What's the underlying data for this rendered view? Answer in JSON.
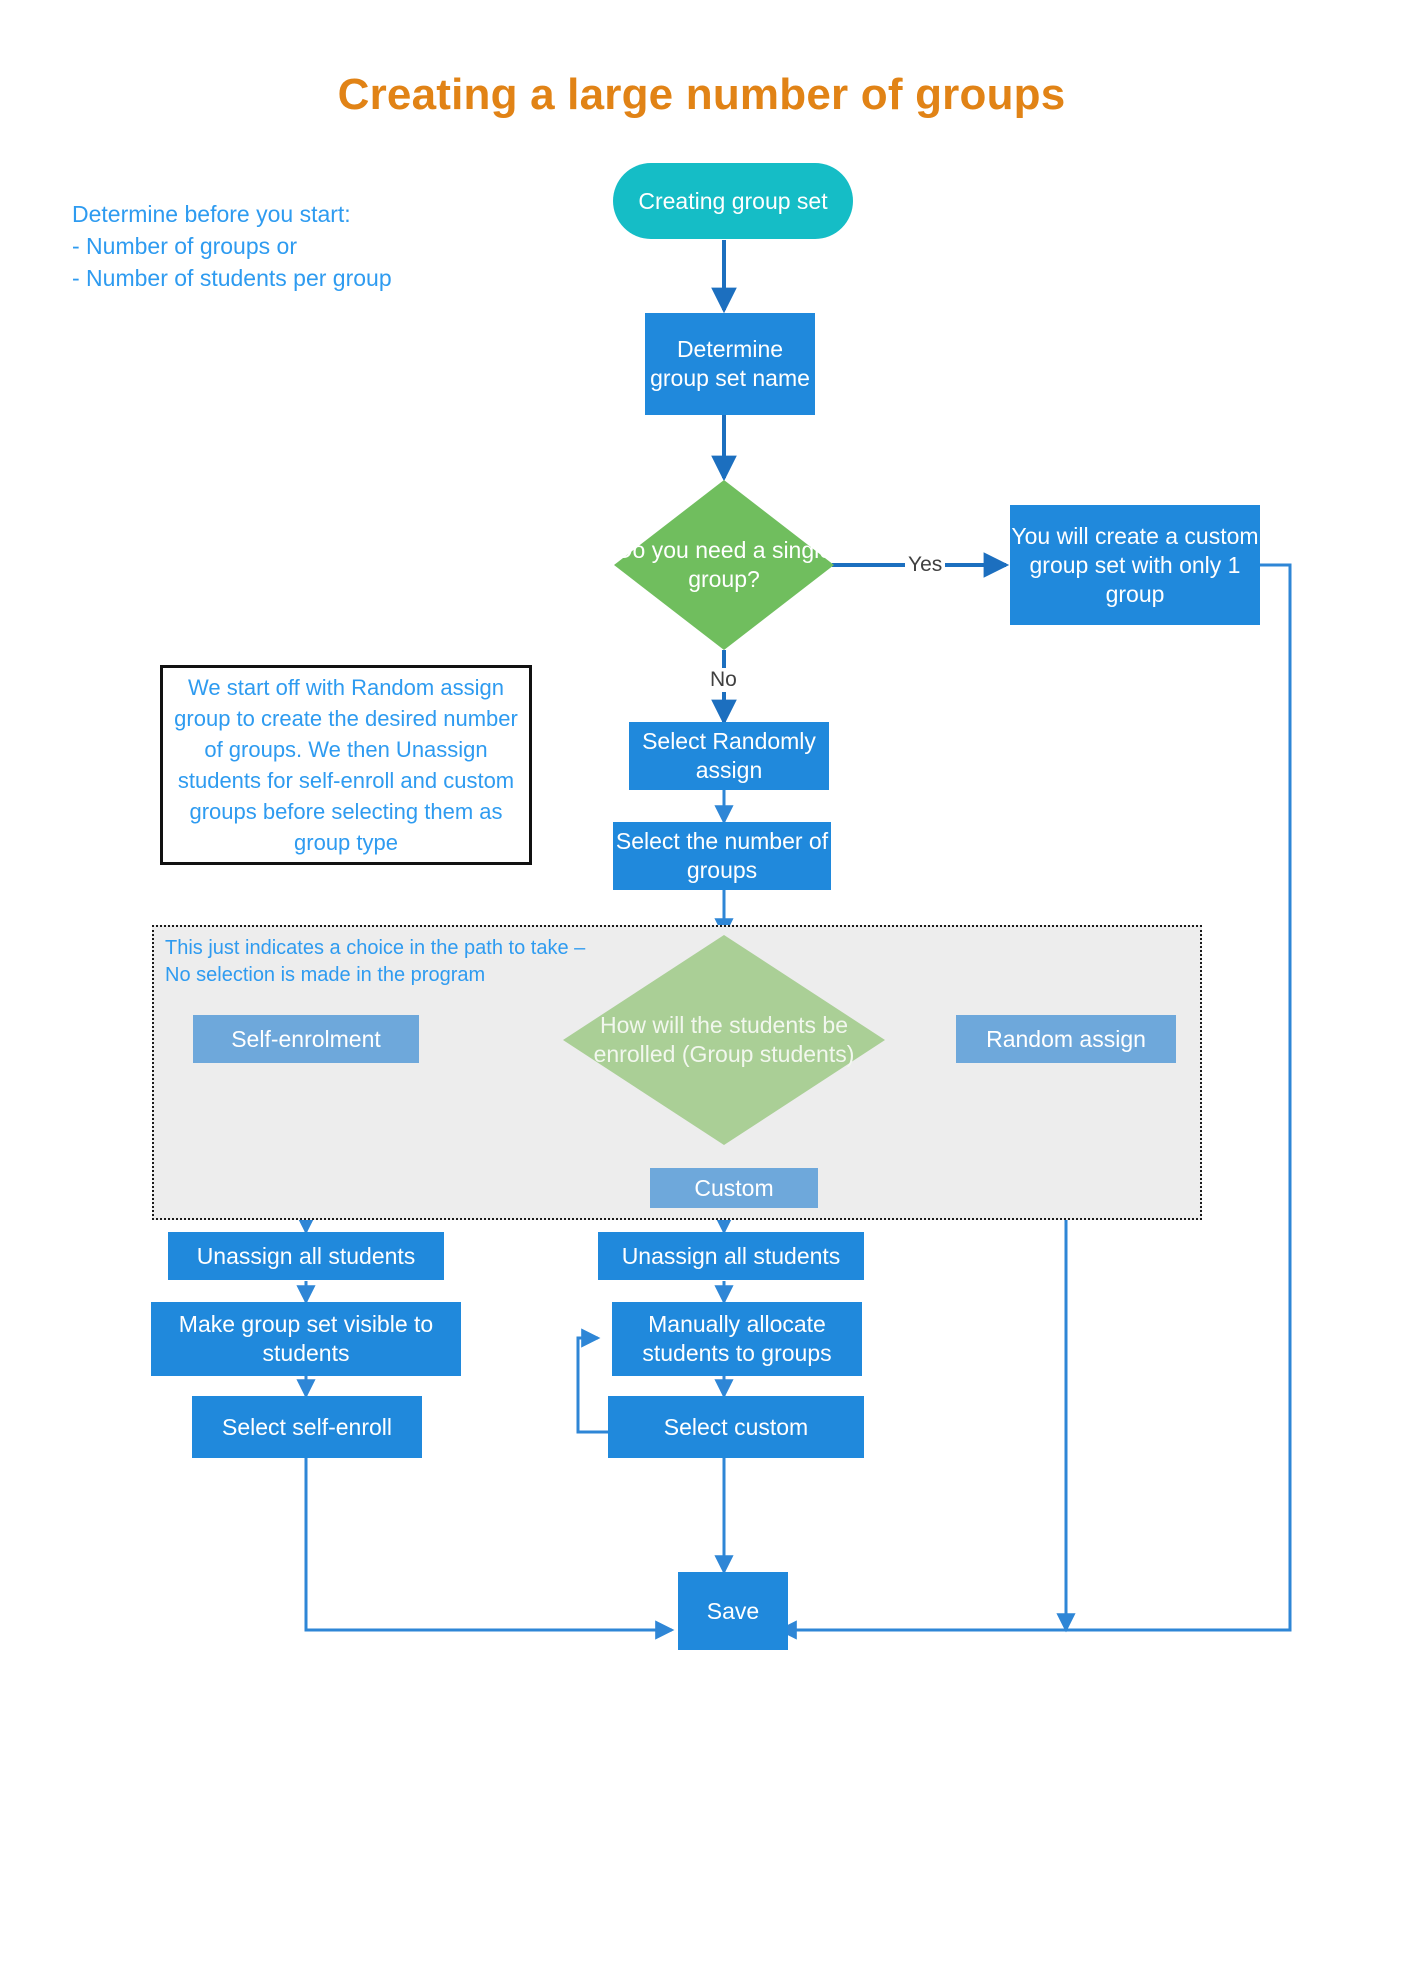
{
  "title": "Creating a large number of groups",
  "colors": {
    "title": "#E18316",
    "note_text": "#2E9BF0",
    "process": "#2089DC",
    "process_faded": "#6EA8DB",
    "start": "#15BDC6",
    "decision": "#70BE5E",
    "decision_faded": "#AACF96",
    "zone_background": "#EDEDED",
    "connector": "#2E86D6"
  },
  "notes": {
    "precheck": "Determine before you start:\n- Number of groups or\n- Number of students per group",
    "callout": "We start off with Random assign group to create the desired number of groups. We then Unassign students for self-enroll and custom groups before selecting them as group type",
    "choice_zone": "This just indicates a choice in the path to take –\nNo selection is made in the program"
  },
  "nodes": {
    "start": "Creating group set",
    "determine_name": "Determine group set name",
    "single_group_decision": "Do you need a single group?",
    "custom_one_group": "You will create a custom group set with only 1 group",
    "select_randomly_assign": "Select Randomly assign",
    "select_number_groups": "Select the number of groups",
    "enrol_decision": "How will the students be enrolled (Group students)",
    "self_enrolment": "Self-enrolment",
    "random_assign": "Random assign",
    "custom": "Custom",
    "unassign_left": "Unassign all students",
    "make_visible": "Make group set visible to students",
    "select_self_enroll": "Select self-enroll",
    "unassign_center": "Unassign all students",
    "manually_allocate": "Manually allocate students to groups",
    "select_custom": "Select custom",
    "save": "Save"
  },
  "edge_labels": {
    "yes": "Yes",
    "no": "No"
  }
}
